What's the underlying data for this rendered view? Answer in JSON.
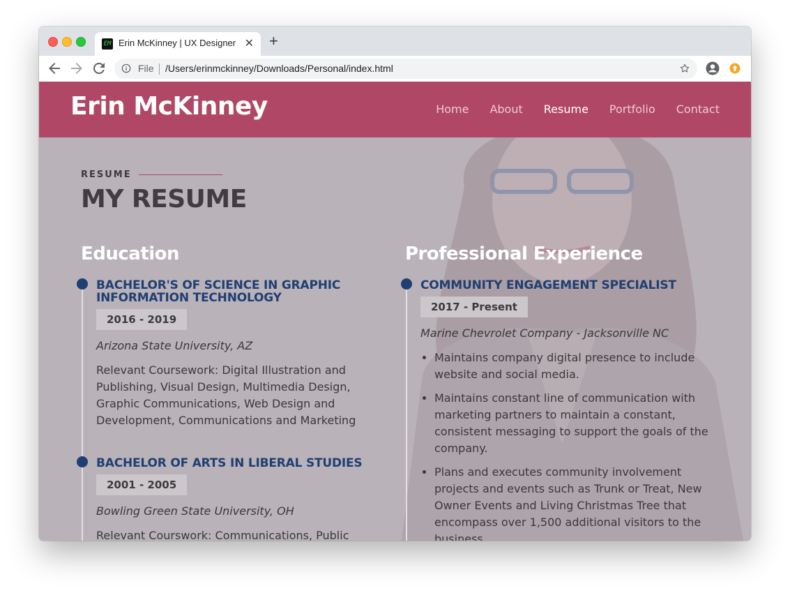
{
  "browser": {
    "tab_title": "Erin McKinney | UX Designer",
    "favicon_text": "EM",
    "url_scheme": "File",
    "url": "/Users/erinmckinney/Downloads/Personal/index.html"
  },
  "site": {
    "logo": "Erin McKinney",
    "nav": [
      "Home",
      "About",
      "Resume",
      "Portfolio",
      "Contact"
    ],
    "active_nav": "Resume",
    "colors": {
      "header": "#b04766",
      "accent_blue": "#1f3f73",
      "page_bg": "#b9b2b8"
    }
  },
  "resume": {
    "eyebrow": "RESUME",
    "heading": "MY RESUME",
    "education": {
      "title": "Education",
      "entries": [
        {
          "title": "BACHELOR'S OF SCIENCE IN GRAPHIC INFORMATION TECHNOLOGY",
          "years": "2016 - 2019",
          "place": "Arizona State University, AZ",
          "desc": "Relevant Coursework: Digital Illustration and Publishing, Visual Design, Multimedia Design, Graphic Communications, Web Design and Development, Communications and Marketing"
        },
        {
          "title": "BACHELOR OF ARTS IN LIBERAL STUDIES",
          "years": "2001 - 2005",
          "place": "Bowling Green State University, OH",
          "desc": "Relevant Courswork: Communications, Public Speaking"
        }
      ]
    },
    "experience": {
      "title": "Professional Experience",
      "entries": [
        {
          "title": "COMMUNITY ENGAGEMENT SPECIALIST",
          "years": "2017 - Present",
          "place": "Marine Chevrolet Company - Jacksonville NC",
          "bullets": [
            "Maintains company digital presence to include website and social media.",
            "Maintains constant line of communication with marketing partners to maintain a constant, consistent messaging to support the goals of the company.",
            "Plans and executes community involvement projects and events such as Trunk or Treat, New Owner Events and Living Christmas Tree that encompass over 1,500 additional visitors to the business."
          ]
        }
      ]
    }
  }
}
